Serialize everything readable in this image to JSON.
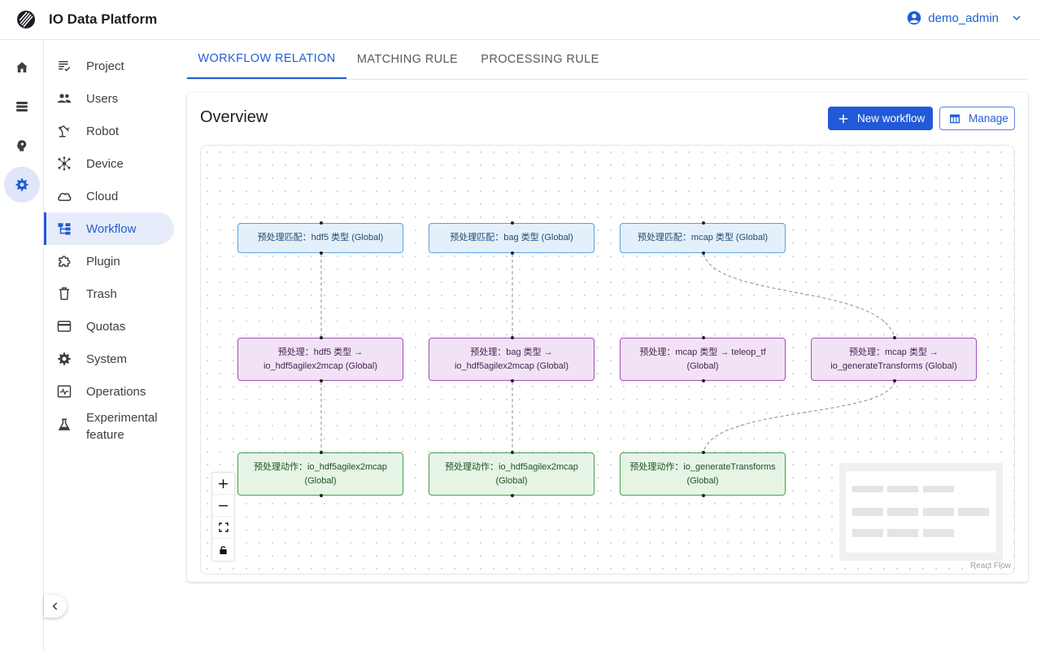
{
  "app": {
    "title": "IO Data Platform"
  },
  "user": {
    "name": "demo_admin"
  },
  "rail": [
    {
      "icon": "home-icon"
    },
    {
      "icon": "storage-icon"
    },
    {
      "icon": "psychology-icon"
    },
    {
      "icon": "settings-icon",
      "active": true
    }
  ],
  "nav": {
    "items": [
      {
        "label": "Project",
        "icon": "project-icon"
      },
      {
        "label": "Users",
        "icon": "users-icon"
      },
      {
        "label": "Robot",
        "icon": "robot-icon"
      },
      {
        "label": "Device",
        "icon": "device-icon"
      },
      {
        "label": "Cloud",
        "icon": "cloud-icon"
      },
      {
        "label": "Workflow",
        "icon": "workflow-icon",
        "active": true
      },
      {
        "label": "Plugin",
        "icon": "plugin-icon"
      },
      {
        "label": "Trash",
        "icon": "trash-icon"
      },
      {
        "label": "Quotas",
        "icon": "quotas-icon"
      },
      {
        "label": "System",
        "icon": "system-icon"
      },
      {
        "label": "Operations",
        "icon": "operations-icon"
      },
      {
        "label": "Experimental feature",
        "icon": "experimental-icon"
      }
    ]
  },
  "tabs": [
    {
      "label": "WORKFLOW RELATION",
      "active": true
    },
    {
      "label": "MATCHING RULE"
    },
    {
      "label": "PROCESSING RULE"
    }
  ],
  "overview": {
    "title": "Overview",
    "new_workflow_label": "New workflow",
    "manage_label": "Manage"
  },
  "flow": {
    "nodes": {
      "m1": "预处理匹配：hdf5 类型 (Global)",
      "m2": "预处理匹配：bag 类型 (Global)",
      "m3": "预处理匹配：mcap 类型 (Global)",
      "p1": "预处理：hdf5 类型 → io_hdf5agilex2mcap (Global)",
      "p2": "预处理：bag 类型 → io_hdf5agilex2mcap (Global)",
      "p3": "预处理：mcap 类型 → teleop_tf (Global)",
      "p4": "预处理：mcap 类型 → io_generateTransforms (Global)",
      "a1": "预处理动作：io_hdf5agilex2mcap (Global)",
      "a2": "预处理动作：io_hdf5agilex2mcap (Global)",
      "a3": "预处理动作：io_generateTransforms (Global)"
    },
    "attribution": "React Flow"
  },
  "colors": {
    "accent": "#2259d8",
    "match_node": "#e3f0fb",
    "process_node": "#f1e3f5",
    "action_node": "#e5f4e5"
  }
}
